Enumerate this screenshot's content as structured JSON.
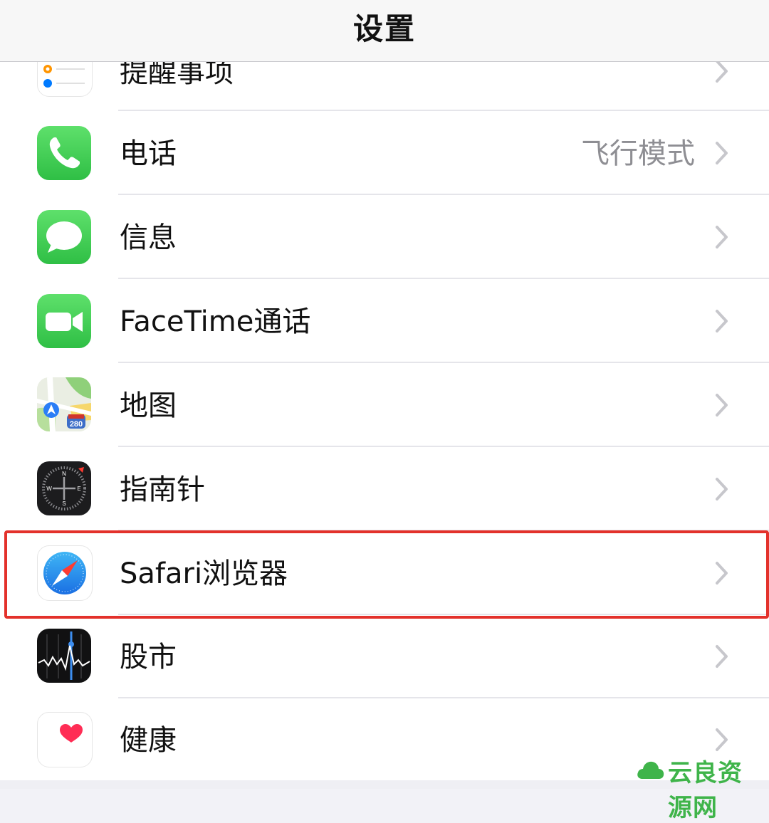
{
  "header": {
    "title": "设置"
  },
  "rows": [
    {
      "label": "提醒事项",
      "icon": "reminders-icon"
    },
    {
      "label": "电话",
      "value": "飞行模式",
      "icon": "phone-icon"
    },
    {
      "label": "信息",
      "icon": "messages-icon"
    },
    {
      "label": "FaceTime通话",
      "icon": "facetime-icon"
    },
    {
      "label": "地图",
      "icon": "maps-icon",
      "badge": "280"
    },
    {
      "label": "指南针",
      "icon": "compass-icon",
      "letters": [
        "N",
        "E",
        "S",
        "W"
      ]
    },
    {
      "label": "Safari浏览器",
      "icon": "safari-icon",
      "highlighted": true
    },
    {
      "label": "股市",
      "icon": "stocks-icon"
    },
    {
      "label": "健康",
      "icon": "health-icon"
    }
  ],
  "colors": {
    "highlight": "#e3312b",
    "green": "#34c759",
    "chevron": "#c7c7cc",
    "secondary_text": "#8e8e93"
  },
  "watermark": {
    "text": "云良资源网",
    "icon": "cloud-icon"
  }
}
